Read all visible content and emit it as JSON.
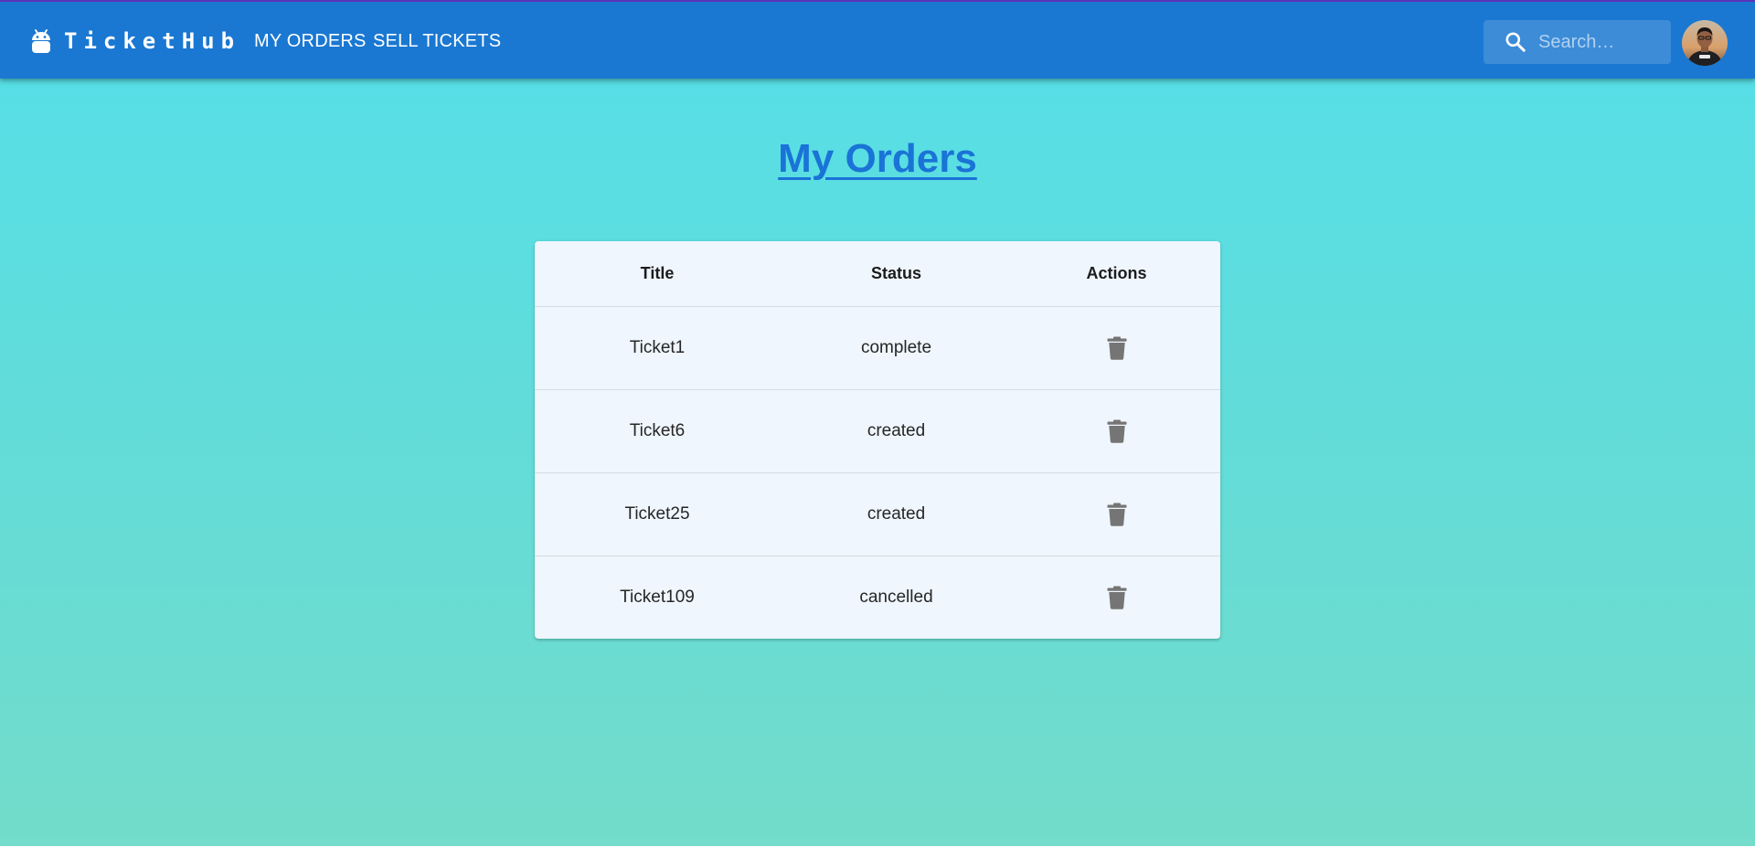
{
  "appbar": {
    "brand": "TicketHub",
    "brand_icon": "android-icon",
    "nav": [
      {
        "label": "MY ORDERS"
      },
      {
        "label": "SELL TICKETS"
      }
    ],
    "search": {
      "placeholder": "Search…",
      "icon": "search-icon"
    },
    "avatar": "user-avatar",
    "color": "#1a78d2"
  },
  "main": {
    "title": "My Orders",
    "title_color": "#1a73d6",
    "table": {
      "columns": [
        "Title",
        "Status",
        "Actions"
      ],
      "rows": [
        {
          "title": "Ticket1",
          "status": "complete",
          "action": "delete-icon"
        },
        {
          "title": "Ticket6",
          "status": "created",
          "action": "delete-icon"
        },
        {
          "title": "Ticket25",
          "status": "created",
          "action": "delete-icon"
        },
        {
          "title": "Ticket109",
          "status": "cancelled",
          "action": "delete-icon"
        }
      ]
    }
  },
  "background": {
    "top": "#54dfe9",
    "bottom": "#73dcca"
  }
}
